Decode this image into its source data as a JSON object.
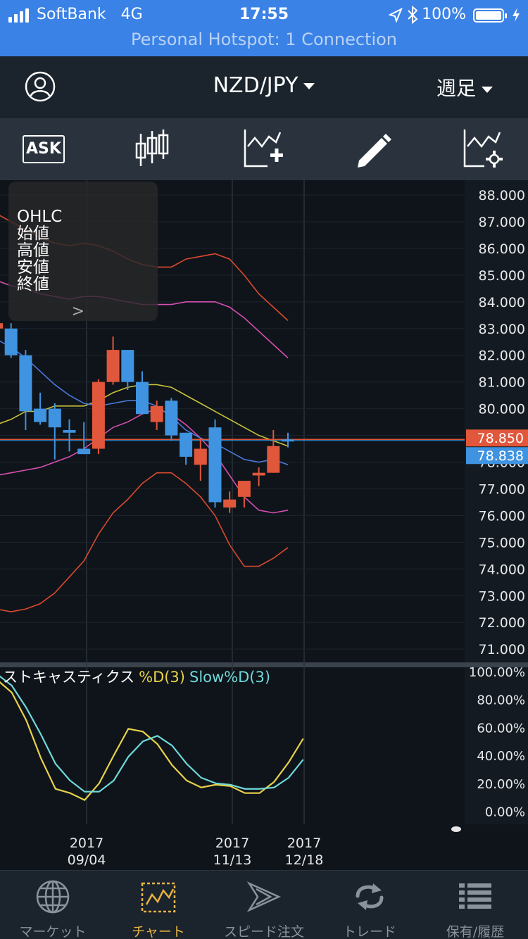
{
  "status_bar": {
    "carrier": "SoftBank",
    "network": "4G",
    "time": "17:55",
    "battery": "100%",
    "hotspot": "Personal Hotspot: 1 Connection"
  },
  "header": {
    "pair": "NZD/JPY",
    "period": "週足"
  },
  "toolbar": {
    "ask_label": "ASK"
  },
  "ohlc_panel": {
    "title": "OHLC",
    "open": "始値",
    "high": "高値",
    "low": "安値",
    "close": "終値"
  },
  "price_axis": {
    "ticks": [
      "88.000",
      "87.000",
      "86.000",
      "85.000",
      "84.000",
      "83.000",
      "82.000",
      "81.000",
      "80.000",
      "78.000",
      "77.000",
      "76.000",
      "75.000",
      "74.000",
      "73.000",
      "72.000",
      "71.000"
    ],
    "ask_price": "78.850",
    "bid_price": "78.838"
  },
  "stoch_axis": {
    "ticks": [
      "100.00%",
      "80.00%",
      "60.00%",
      "40.00%",
      "20.00%",
      "0.00%"
    ]
  },
  "stochastics_legend": {
    "name": "ストキャスティクス",
    "pct_d": "%D(3)",
    "slow_d": "Slow%D(3)"
  },
  "date_labels": [
    {
      "year": "2017",
      "md": "09/04"
    },
    {
      "year": "2017",
      "md": "11/13"
    },
    {
      "year": "2017",
      "md": "12/18"
    }
  ],
  "colors": {
    "up": "#e0573c",
    "down": "#3f93e0",
    "ask_badge": "#e0573c",
    "bid_badge": "#3f93e0",
    "pct_d": "#e8d24a",
    "slow_d": "#6fd8d8"
  },
  "tabs": [
    {
      "label": "マーケット",
      "icon": "globe-icon"
    },
    {
      "label": "チャート",
      "icon": "chart-icon"
    },
    {
      "label": "スピード注文",
      "icon": "speed-arrow-icon"
    },
    {
      "label": "トレード",
      "icon": "refresh-icon"
    },
    {
      "label": "保有/履歴",
      "icon": "list-icon"
    }
  ],
  "chart_data": [
    {
      "type": "candlestick",
      "title": "NZD/JPY",
      "ylim": [
        70.5,
        88.5
      ],
      "candles": [
        {
          "o": 83.0,
          "h": 83.5,
          "l": 82.0,
          "c": 83.2
        },
        {
          "o": 83.0,
          "h": 83.2,
          "l": 81.9,
          "c": 82.0
        },
        {
          "o": 82.0,
          "h": 82.2,
          "l": 79.2,
          "c": 79.9
        },
        {
          "o": 80.0,
          "h": 80.6,
          "l": 79.4,
          "c": 79.5
        },
        {
          "o": 80.0,
          "h": 80.2,
          "l": 78.1,
          "c": 79.3
        },
        {
          "o": 79.2,
          "h": 79.6,
          "l": 78.4,
          "c": 79.1
        },
        {
          "o": 78.5,
          "h": 79.5,
          "l": 78.3,
          "c": 78.3
        },
        {
          "o": 78.5,
          "h": 81.1,
          "l": 78.3,
          "c": 81.0
        },
        {
          "o": 81.0,
          "h": 82.7,
          "l": 80.9,
          "c": 82.2
        },
        {
          "o": 82.2,
          "h": 82.2,
          "l": 80.7,
          "c": 81.0
        },
        {
          "o": 81.0,
          "h": 81.4,
          "l": 79.8,
          "c": 79.8
        },
        {
          "o": 79.5,
          "h": 80.3,
          "l": 79.2,
          "c": 80.1
        },
        {
          "o": 80.3,
          "h": 80.4,
          "l": 78.8,
          "c": 79.0
        },
        {
          "o": 79.1,
          "h": 79.1,
          "l": 77.9,
          "c": 78.2
        },
        {
          "o": 77.9,
          "h": 78.9,
          "l": 77.3,
          "c": 78.5
        },
        {
          "o": 79.3,
          "h": 79.6,
          "l": 76.3,
          "c": 76.5
        },
        {
          "o": 76.3,
          "h": 76.9,
          "l": 76.1,
          "c": 76.6
        },
        {
          "o": 76.7,
          "h": 77.3,
          "l": 76.3,
          "c": 77.3
        },
        {
          "o": 77.5,
          "h": 77.8,
          "l": 77.1,
          "c": 77.6
        },
        {
          "o": 77.6,
          "h": 79.2,
          "l": 77.6,
          "c": 78.6
        },
        {
          "o": 78.85,
          "h": 79.1,
          "l": 78.55,
          "c": 78.84
        }
      ],
      "bollinger_bands": [
        {
          "name": "+2σ",
          "color": "#d84a2e",
          "values": [
            87.3,
            87.0,
            86.7,
            86.4,
            86.2,
            86.1,
            86.2,
            86.1,
            85.9,
            85.6,
            85.4,
            85.3,
            85.3,
            85.6,
            85.7,
            85.8,
            85.6,
            85.0,
            84.3,
            83.8,
            83.3
          ]
        },
        {
          "name": "+1σ",
          "color": "#d64fb2",
          "values": [
            84.8,
            84.6,
            84.5,
            84.3,
            84.2,
            84.1,
            84.2,
            84.2,
            84.1,
            84.0,
            83.9,
            83.9,
            83.9,
            84.0,
            84.0,
            84.0,
            83.8,
            83.4,
            82.9,
            82.4,
            81.9
          ]
        },
        {
          "name": "MA",
          "color": "#c9c23a",
          "values": [
            79.4,
            79.6,
            79.9,
            79.9,
            80.1,
            80.1,
            80.1,
            80.3,
            80.6,
            80.8,
            80.9,
            80.9,
            80.8,
            80.5,
            80.2,
            79.9,
            79.6,
            79.3,
            79.0,
            78.8,
            78.6
          ]
        },
        {
          "name": "-1σ",
          "color": "#d64fb2",
          "values": [
            77.5,
            77.6,
            77.7,
            77.8,
            78.0,
            78.2,
            78.5,
            78.9,
            79.3,
            79.5,
            79.8,
            80.0,
            79.8,
            79.4,
            78.9,
            78.3,
            77.5,
            76.7,
            76.2,
            76.1,
            76.2
          ]
        },
        {
          "name": "-2σ",
          "color": "#d84a2e",
          "values": [
            72.5,
            72.4,
            72.5,
            72.7,
            73.1,
            73.7,
            74.3,
            75.3,
            76.1,
            76.6,
            77.2,
            77.6,
            77.6,
            77.2,
            76.7,
            76.0,
            74.9,
            74.1,
            74.1,
            74.4,
            74.8
          ]
        }
      ]
    },
    {
      "type": "line",
      "title": "ストキャスティクス",
      "ylim": [
        0,
        100
      ],
      "series": [
        {
          "name": "%D(3)",
          "color": "#e8d24a",
          "values": [
            94,
            85,
            65,
            38,
            16,
            13,
            8,
            20,
            40,
            59,
            57,
            48,
            33,
            22,
            17,
            19,
            18,
            13,
            13,
            21,
            35,
            52
          ]
        },
        {
          "name": "Slow%D(3)",
          "color": "#6fd8d8",
          "values": [
            98,
            90,
            74,
            55,
            34,
            22,
            14,
            14,
            22,
            39,
            50,
            54,
            47,
            34,
            24,
            20,
            19,
            16,
            16,
            17,
            24,
            37
          ]
        }
      ]
    }
  ]
}
